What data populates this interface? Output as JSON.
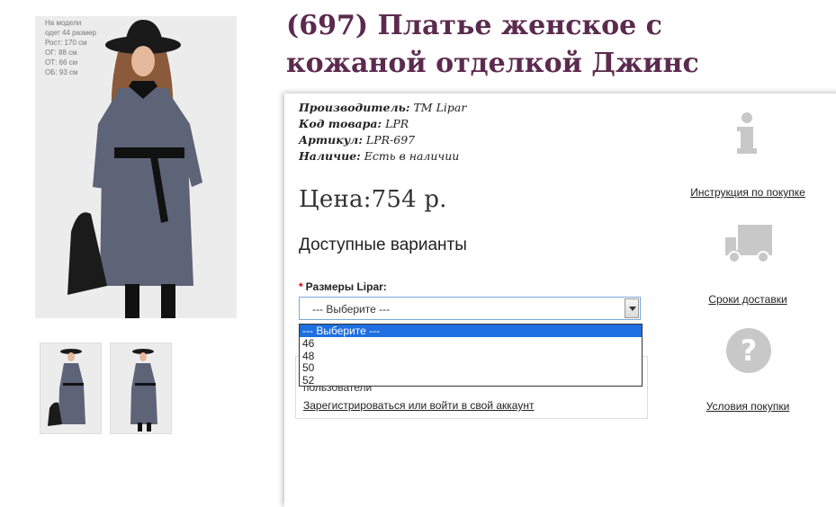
{
  "product": {
    "title": "(697) Платье женское с кожаной отделкой Джинс",
    "photo_note": [
      "На модели",
      "одет 44 размер",
      "Рост: 170 см",
      "ОГ: 88 см",
      "ОТ: 66 см",
      "ОБ: 93 см"
    ],
    "meta": {
      "manufacturer_label": "Производитель:",
      "manufacturer": "ТМ Lipar",
      "code_label": "Код товара:",
      "code": "LPR",
      "article_label": "Артикул:",
      "article": "LPR-697",
      "stock_label": "Наличие:",
      "stock": "Есть в наличии"
    },
    "price": "Цена:754 р.",
    "variants_heading": "Доступные варианты",
    "size_label": "Размеры Lipar:",
    "size_required": "*",
    "select_value": "--- Выберите ---",
    "size_options": [
      "--- Выберите ---",
      "46",
      "48",
      "50",
      "52"
    ],
    "login_text": "пользователи",
    "login_link": "Зарегистрироваться или войти в свой аккаунт"
  },
  "side": {
    "instruction": "Инструкция по покупке",
    "delivery": "Сроки доставки",
    "terms": "Условия покупки"
  },
  "colors": {
    "title": "#5b2a4e",
    "dress": "#5d6478",
    "selection": "#1e6fe0",
    "icon": "#c8c8c8"
  }
}
